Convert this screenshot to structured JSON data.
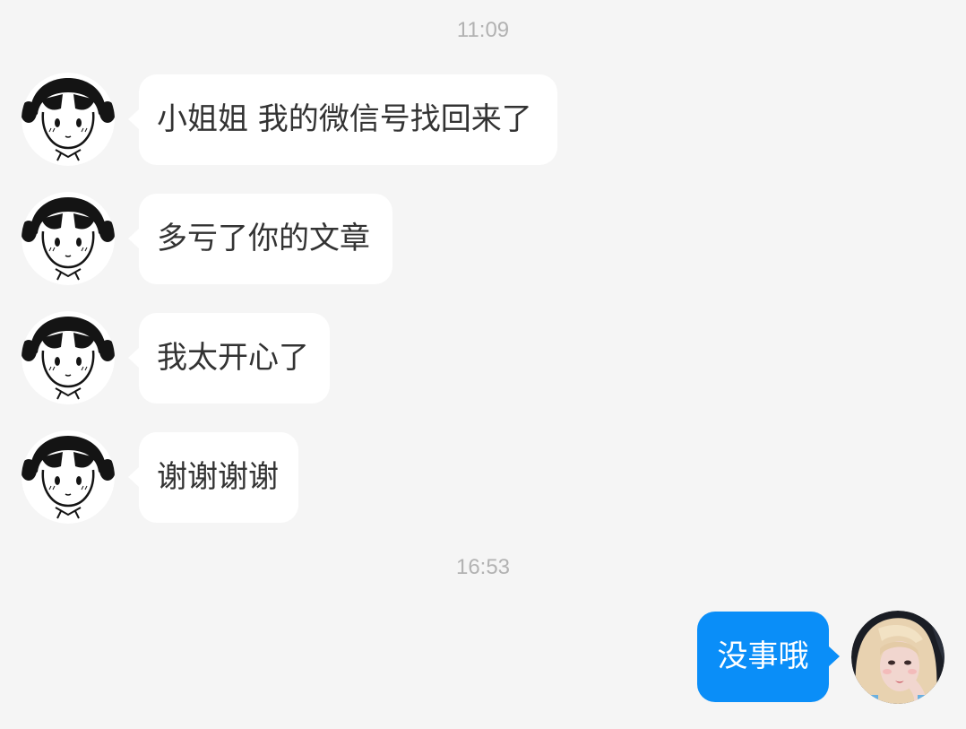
{
  "timestamps": [
    "11:09",
    "16:53"
  ],
  "incoming_messages": [
    {
      "text": "小姐姐 我的微信号找回来了",
      "avatar": "cartoon-girl-avatar"
    },
    {
      "text": "多亏了你的文章",
      "avatar": "cartoon-girl-avatar"
    },
    {
      "text": "我太开心了",
      "avatar": "cartoon-girl-avatar"
    },
    {
      "text": "谢谢谢谢",
      "avatar": "cartoon-girl-avatar"
    }
  ],
  "outgoing_messages": [
    {
      "text": "没事哦",
      "avatar": "user-photo-avatar"
    }
  ],
  "colors": {
    "background": "#f5f5f5",
    "incoming_bubble": "#ffffff",
    "outgoing_bubble": "#0a8ef8",
    "timestamp_text": "#b2b2b2"
  }
}
